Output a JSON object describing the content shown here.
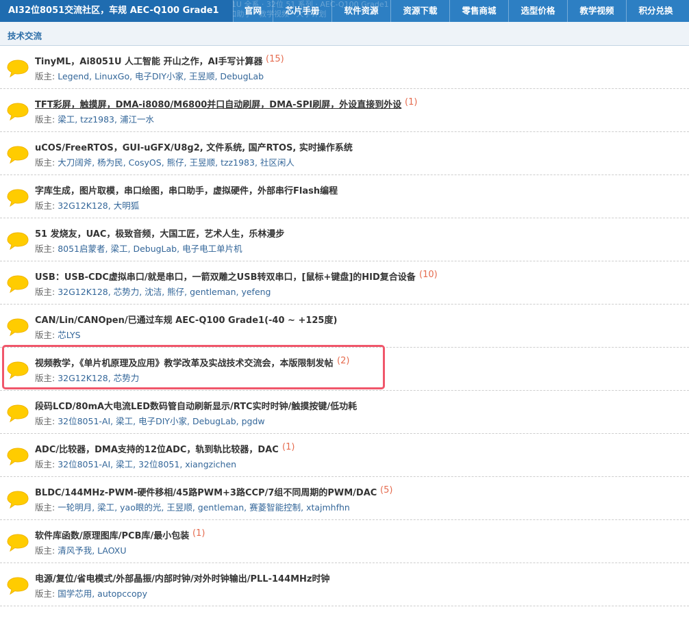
{
  "nav": {
    "brand": "AI32位8051交流社区，车规 AEC-Q100 Grade1",
    "items": [
      {
        "label": "官网",
        "width": 58
      },
      {
        "label": "芯片手册",
        "width": 86
      },
      {
        "label": "软件资源",
        "width": 86
      },
      {
        "label": "资源下载",
        "width": 86
      },
      {
        "label": "零售商城",
        "width": 86
      },
      {
        "label": "选型价格",
        "width": 86
      },
      {
        "label": "教学视频",
        "width": 86
      },
      {
        "label": "积分兑换",
        "width": 86
      }
    ],
    "ticker_line1": "。。。Tab 51 示例代码 · FreeRTOS 演示 · 国产 RTOS 已移植 · Ai8051U 全系 · 32位 51 系列 · AEC-Q100 Grade1",
    "ticker_line2": "TinyML · Ai8051U 人工智能 · 开山之作 · USB-CDC · 虚拟串口 · 串口助手 · 教学视频 · 大学计划"
  },
  "section": {
    "title": "技术交流"
  },
  "mods_prefix": "版主:",
  "forums": [
    {
      "title": "TinyML，Ai8051U 人工智能 开山之作，AI手写计算器",
      "count": "(15)",
      "mods": [
        "Legend",
        "LinuxGo",
        "电子DIY小家",
        "王昱顺",
        "DebugLab"
      ]
    },
    {
      "title": "TFT彩屏，触摸屏，DMA-i8080/M6800并口自动刷屏，DMA-SPI刷屏，外设直接到外设",
      "count": "(1)",
      "underlined": true,
      "mods": [
        "梁工",
        "tzz1983",
        "浦江一水"
      ]
    },
    {
      "title": "uCOS/FreeRTOS，GUI-uGFX/U8g2, 文件系统, 国产RTOS, 实时操作系统",
      "count": "",
      "mods": [
        "大刀阔斧",
        "杨为民",
        "CosyOS",
        "熊仔",
        "王昱顺",
        "tzz1983",
        "社区闲人"
      ]
    },
    {
      "title": "字库生成，图片取模，串口绘图，串口助手，虚拟硬件，外部串行Flash编程",
      "count": "",
      "mods": [
        "32G12K128",
        "大明狐"
      ]
    },
    {
      "title": "51 发烧友，UAC，极致音频，大国工匠，艺术人生，乐林漫步",
      "count": "",
      "mods": [
        "8051启蒙者",
        "梁工",
        "DebugLab",
        "电子电工单片机"
      ]
    },
    {
      "title": "USB：USB-CDC虚拟串口/就是串口，一箭双雕之USB转双串口，[鼠标+键盘]的HID复合设备",
      "count": "(10)",
      "mods": [
        "32G12K128",
        "芯势力",
        "沈洁",
        "熊仔",
        "gentleman",
        "yefeng"
      ]
    },
    {
      "title": "CAN/Lin/CANOpen/已通过车规 AEC-Q100 Grade1(-40 ~ +125度)",
      "count": "",
      "mods": [
        "芯LYS"
      ]
    },
    {
      "title": "视频教学，《单片机原理及应用》教学改革及实战技术交流会，本版限制发帖",
      "count": "(2)",
      "mods": [
        "32G12K128",
        "芯势力"
      ]
    },
    {
      "title": "段码LCD/80mA大电流LED数码管自动刷新显示/RTC实时时钟/触摸按键/低功耗",
      "count": "",
      "mods": [
        "32位8051-AI",
        "梁工",
        "电子DIY小家",
        "DebugLab",
        "pgdw"
      ]
    },
    {
      "title": "ADC/比较器，DMA支持的12位ADC，轨到轨比较器，DAC",
      "count": "(1)",
      "mods": [
        "32位8051-AI",
        "梁工",
        "32位8051",
        "xiangzichen"
      ]
    },
    {
      "title": "BLDC/144MHz-PWM-硬件移相/45路PWM+3路CCP/7组不同周期的PWM/DAC",
      "count": "(5)",
      "mods": [
        "一轮明月",
        "梁工",
        "yao眼的光",
        "王昱顺",
        "gentleman",
        "赛菱智能控制",
        "xtajmhfhn"
      ]
    },
    {
      "title": "软件库函数/原理图库/PCB库/最小包装",
      "count": "(1)",
      "mods": [
        "清风予我",
        "LAOXU"
      ]
    },
    {
      "title": "电源/复位/省电模式/外部晶振/内部时钟/对外时钟输出/PLL-144MHz时钟",
      "count": "",
      "mods": [
        "国学芯用",
        "autopccopy"
      ]
    }
  ],
  "colors": {
    "nav_bg": "#2d7fc3",
    "brand_bg": "#1f6cb0",
    "link": "#336699",
    "count": "#e56b4e",
    "bubble": "#ffcc00",
    "highlight": "#f0566a"
  },
  "icons": {
    "forum": "speech-bubble-icon"
  }
}
